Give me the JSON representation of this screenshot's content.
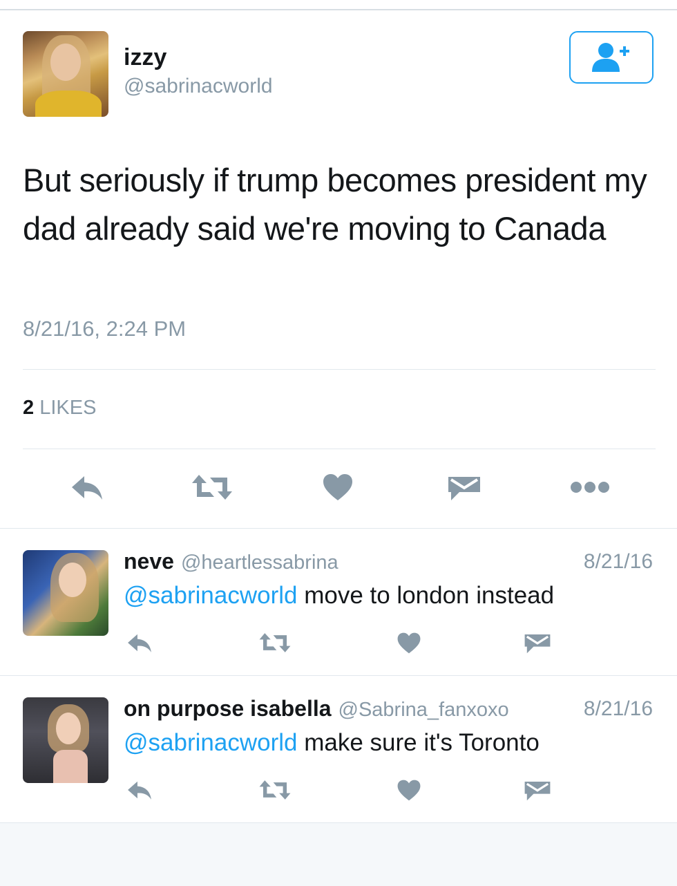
{
  "tweet": {
    "author_name": "izzy",
    "author_handle": "@sabrinacworld",
    "text": "But seriously if trump becomes president my dad already said we're moving to Canada",
    "timestamp": "8/21/16, 2:24 PM",
    "likes_count": "2",
    "likes_label": "LIKES"
  },
  "actions": [
    "reply-icon",
    "retweet-icon",
    "like-icon",
    "direct-message-icon",
    "more-icon"
  ],
  "replies": [
    {
      "name": "neve",
      "handle": "@heartlessabrina",
      "date": "8/21/16",
      "mention": "@sabrinacworld",
      "text": " move to london instead"
    },
    {
      "name": "on purpose isabella",
      "handle": "@Sabrina_fanxoxo",
      "date": "8/21/16",
      "mention": "@sabrinacworld",
      "text": " make sure it's Toronto"
    }
  ],
  "colors": {
    "accent": "#1da1f2",
    "icon_gray": "#8899a6",
    "text": "#14171a",
    "divider": "#e1e8ed"
  }
}
